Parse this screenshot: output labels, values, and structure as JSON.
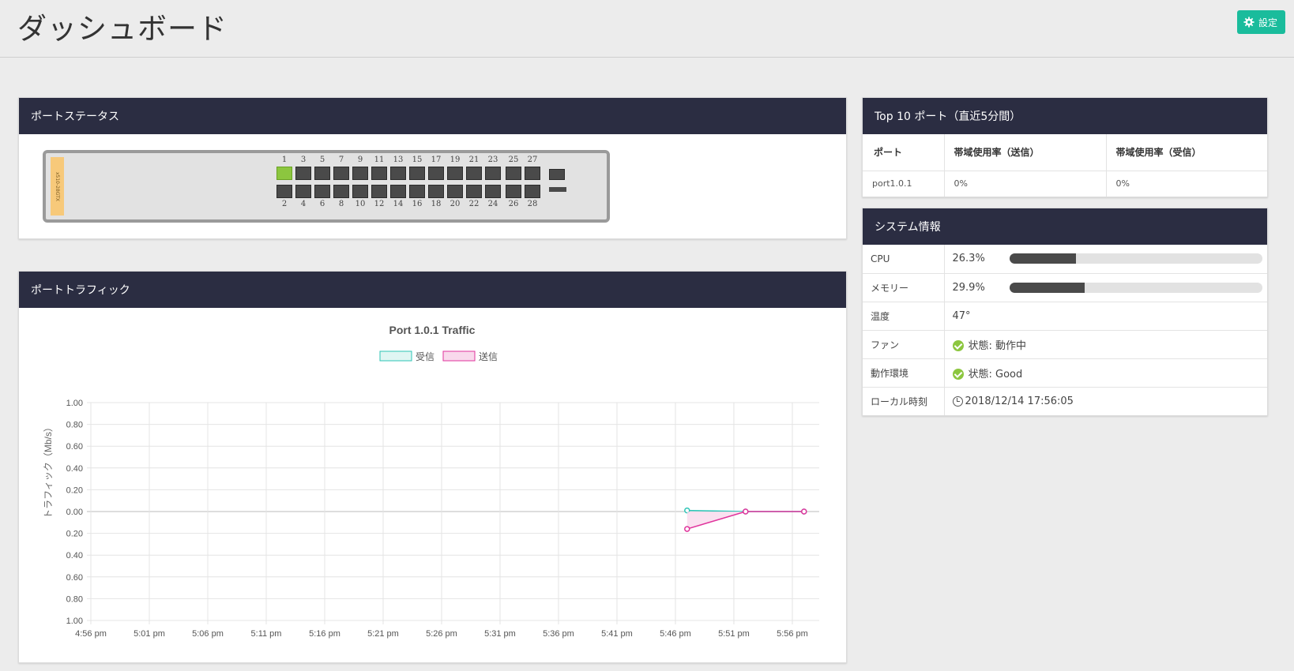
{
  "header": {
    "title": "ダッシュボード",
    "settings_label": "設定"
  },
  "port_status": {
    "title": "ポートステータス",
    "model": "x510-28GTX",
    "top_numbers": [
      "1",
      "3",
      "5",
      "7",
      "9",
      "11",
      "13",
      "15",
      "17",
      "19",
      "21",
      "23",
      "25",
      "27"
    ],
    "bottom_numbers": [
      "2",
      "4",
      "6",
      "8",
      "10",
      "12",
      "14",
      "16",
      "18",
      "20",
      "22",
      "24",
      "26",
      "28"
    ],
    "link_up_ports": [
      "1"
    ]
  },
  "traffic": {
    "title": "ポートトラフィック"
  },
  "chart_data": {
    "type": "line",
    "title": "Port 1.0.1 Traffic",
    "ylabel": "トラフィック（Mb/s）",
    "xlabel": "",
    "x_ticks": [
      "4:56 pm",
      "5:01 pm",
      "5:06 pm",
      "5:11 pm",
      "5:16 pm",
      "5:21 pm",
      "5:26 pm",
      "5:31 pm",
      "5:36 pm",
      "5:41 pm",
      "5:46 pm",
      "5:51 pm",
      "5:56 pm"
    ],
    "y_ticks": [
      "1.00",
      "0.80",
      "0.60",
      "0.40",
      "0.20",
      "0.00",
      "0.20",
      "0.40",
      "0.60",
      "0.80",
      "1.00"
    ],
    "ylim": [
      -1.0,
      1.0
    ],
    "legend_position": "top-center",
    "grid": true,
    "series": [
      {
        "name": "受信",
        "color": "#2ec4b6",
        "fill": "#dff6f3",
        "x": [
          "5:47 pm",
          "5:52 pm",
          "5:57 pm"
        ],
        "values": [
          0.01,
          0.0,
          0.0
        ]
      },
      {
        "name": "送信",
        "color": "#e0349c",
        "fill": "#f9d9ec",
        "x": [
          "5:47 pm",
          "5:52 pm",
          "5:57 pm"
        ],
        "values": [
          -0.16,
          0.0,
          0.0
        ]
      }
    ]
  },
  "top10": {
    "title": "Top 10 ポート（直近5分間）",
    "headers": [
      "ポート",
      "帯域使用率（送信）",
      "帯域使用率（受信）"
    ],
    "rows": [
      [
        "port1.0.1",
        "0%",
        "0%"
      ]
    ]
  },
  "sysinfo": {
    "title": "システム情報",
    "cpu_label": "CPU",
    "cpu_value": "26.3%",
    "cpu_fraction": 0.263,
    "mem_label": "メモリー",
    "mem_value": "29.9%",
    "mem_fraction": 0.299,
    "temp_label": "温度",
    "temp_value": "47°",
    "fan_label": "ファン",
    "fan_value": "状態: 動作中",
    "env_label": "動作環境",
    "env_value": "状態: Good",
    "time_label": "ローカル時刻",
    "time_value": "2018/12/14 17:56:05"
  }
}
